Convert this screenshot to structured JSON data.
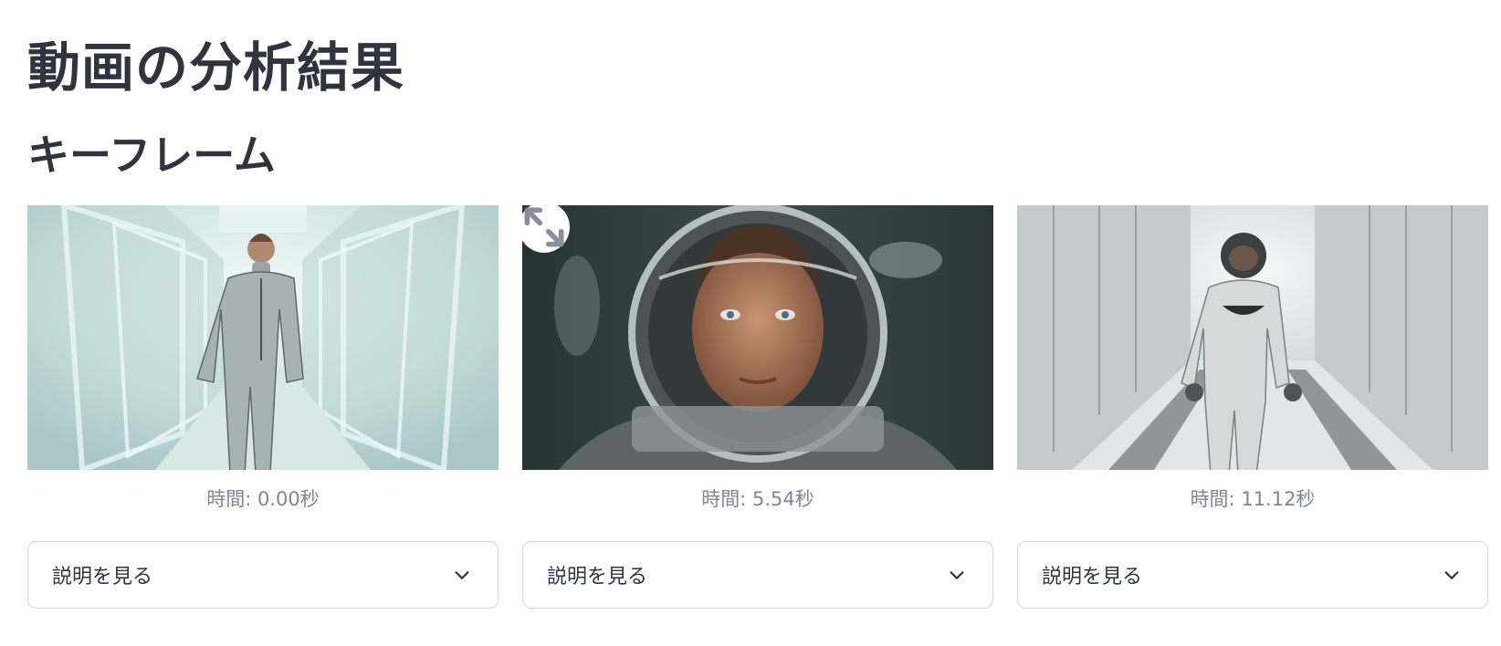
{
  "page": {
    "title": "動画の分析結果",
    "section_title": "キーフレーム"
  },
  "keyframes": [
    {
      "time_label": "時間: 0.00秒",
      "expander_label": "説明を見る",
      "image": "man-in-silver-suit-in-white-corridor"
    },
    {
      "time_label": "時間: 5.54秒",
      "expander_label": "説明を見る",
      "image": "man-in-astronaut-helmet-closeup"
    },
    {
      "time_label": "時間: 11.12秒",
      "expander_label": "説明を見る",
      "image": "astronaut-walking-in-white-hallway"
    }
  ],
  "icons": {
    "expand": "fullscreen-expand-icon",
    "chevron": "chevron-down-icon"
  }
}
